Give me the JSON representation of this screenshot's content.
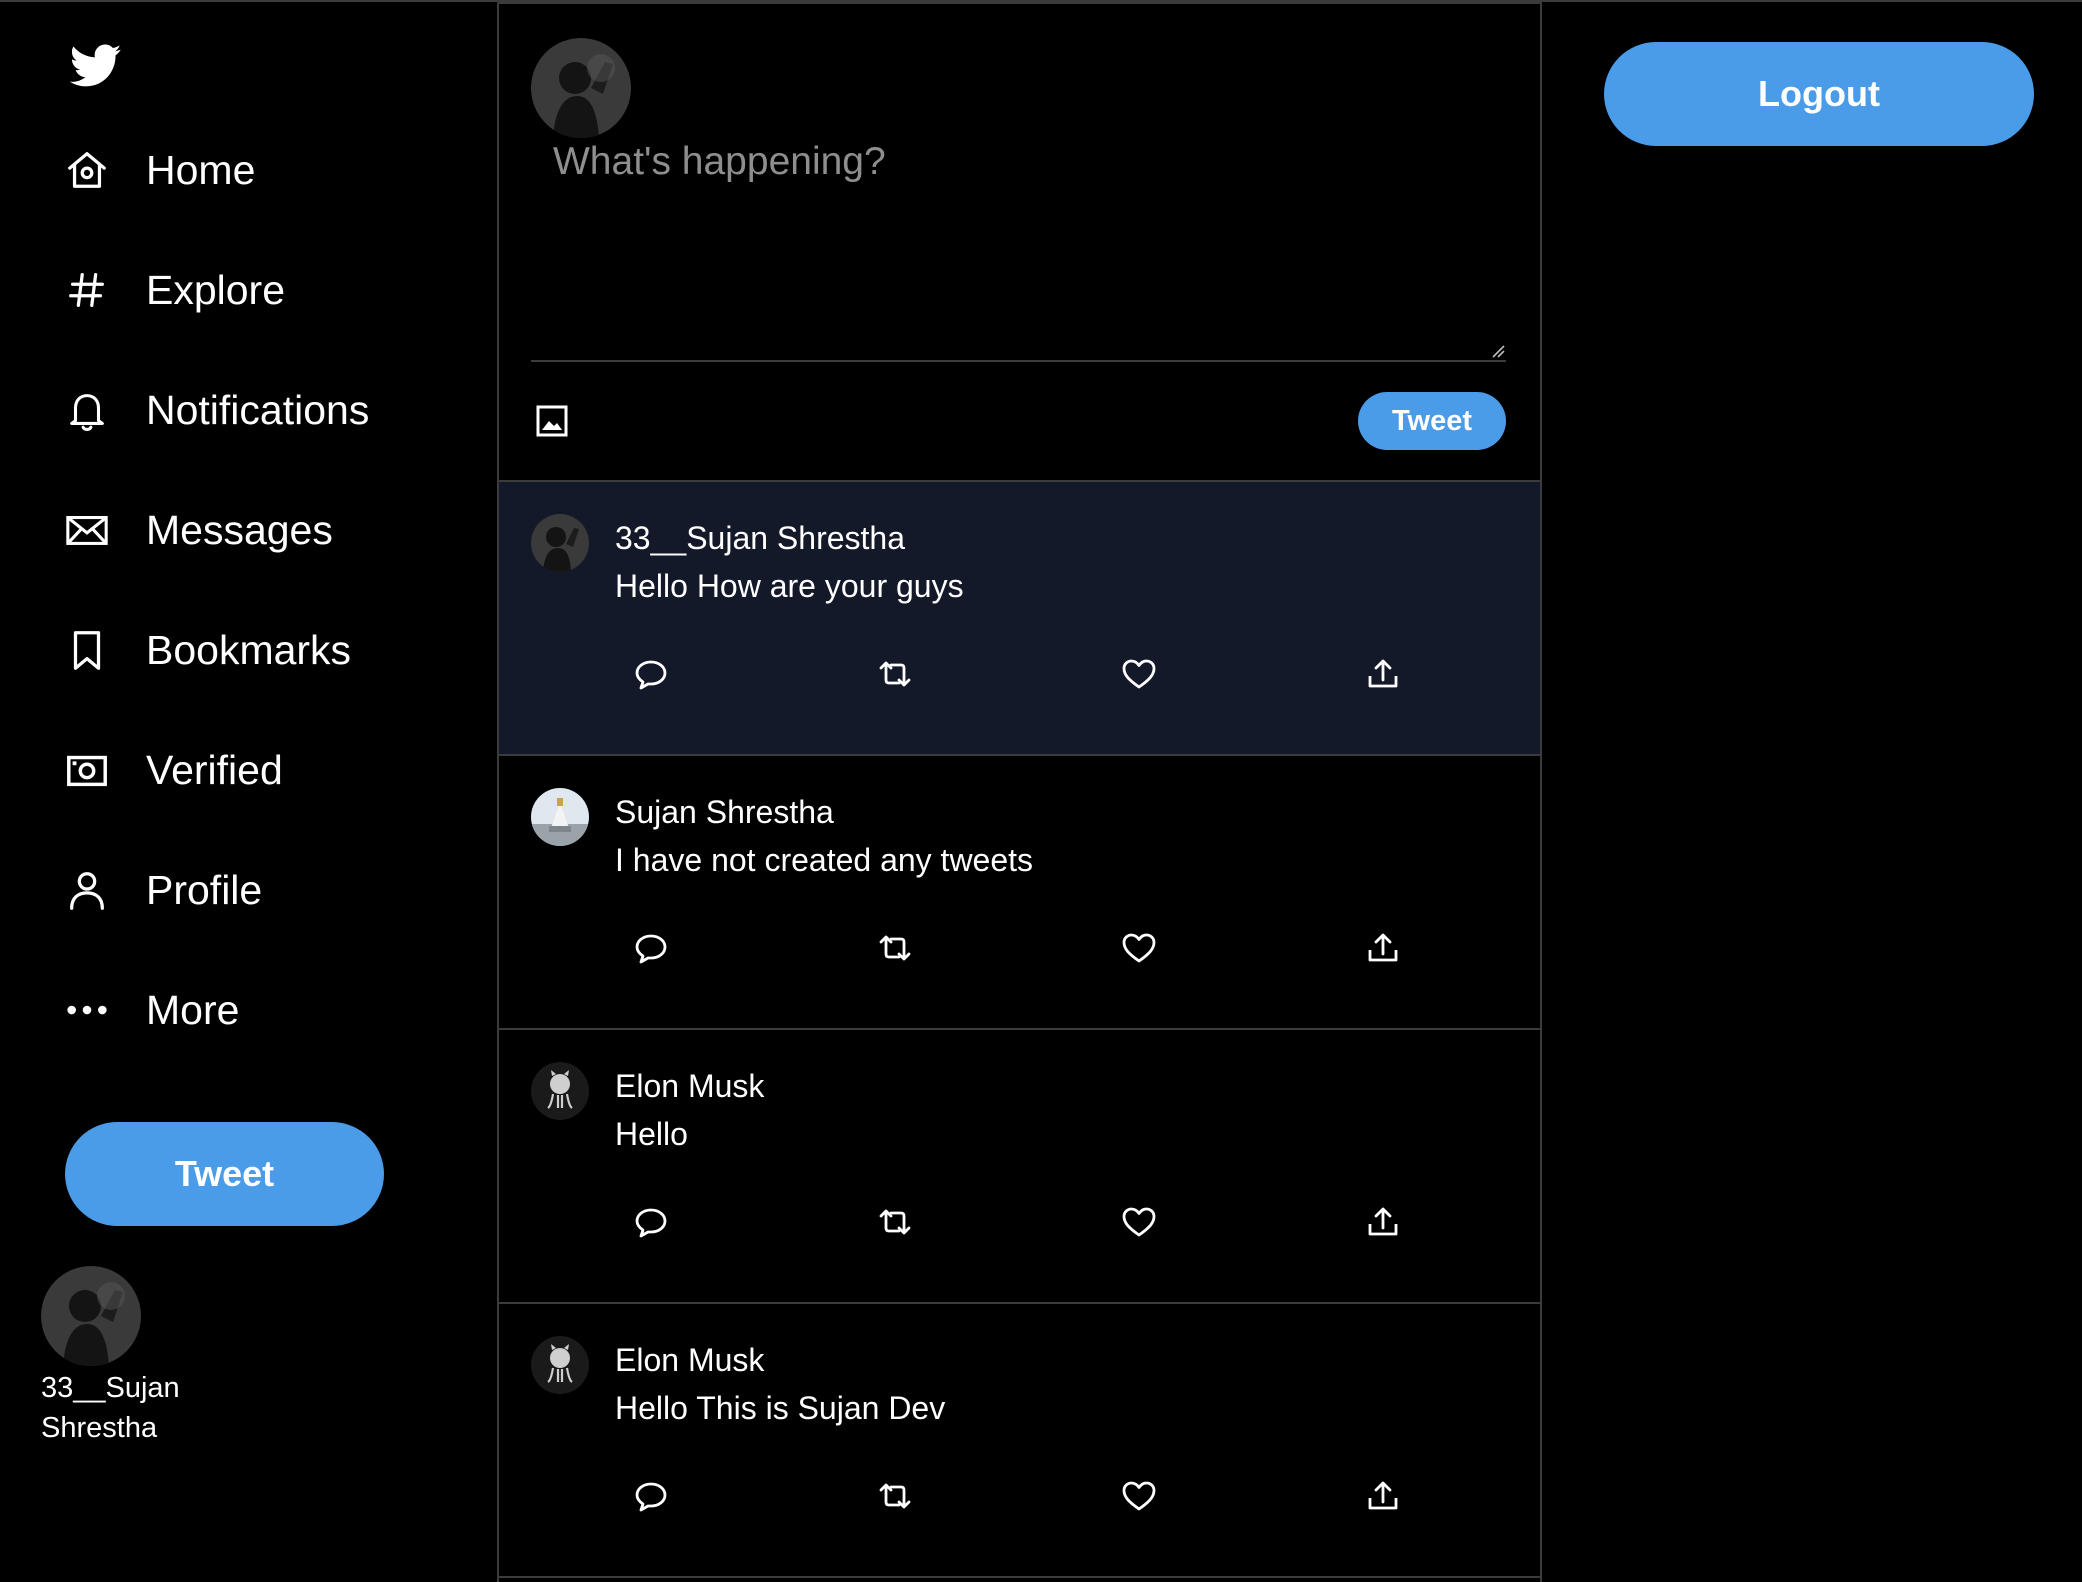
{
  "sidebar": {
    "logo_icon": "twitter-bird-icon",
    "items": [
      {
        "label": "Home",
        "icon": "home-icon"
      },
      {
        "label": "Explore",
        "icon": "hashtag-icon"
      },
      {
        "label": "Notifications",
        "icon": "bell-icon"
      },
      {
        "label": "Messages",
        "icon": "envelope-icon"
      },
      {
        "label": "Bookmarks",
        "icon": "bookmark-icon"
      },
      {
        "label": "Verified",
        "icon": "verified-icon"
      },
      {
        "label": "Profile",
        "icon": "person-icon"
      },
      {
        "label": "More",
        "icon": "more-dots-icon"
      }
    ],
    "tweet_label": "Tweet",
    "user": {
      "name": "33__Sujan Shrestha"
    }
  },
  "composer": {
    "placeholder": "What's happening?",
    "tweet_label": "Tweet"
  },
  "tweets": [
    {
      "author": "33__Sujan Shrestha",
      "text": "Hello How are your guys",
      "highlight": true
    },
    {
      "author": "Sujan Shrestha",
      "text": "I have not created any tweets",
      "highlight": false
    },
    {
      "author": "Elon Musk",
      "text": "Hello",
      "highlight": false
    },
    {
      "author": "Elon Musk",
      "text": "Hello This is Sujan Dev",
      "highlight": false
    }
  ],
  "header": {
    "logout_label": "Logout"
  },
  "colors": {
    "accent": "#4a9be8",
    "background": "#000000",
    "border": "#3b3b3b",
    "highlight_row": "#14192a"
  }
}
